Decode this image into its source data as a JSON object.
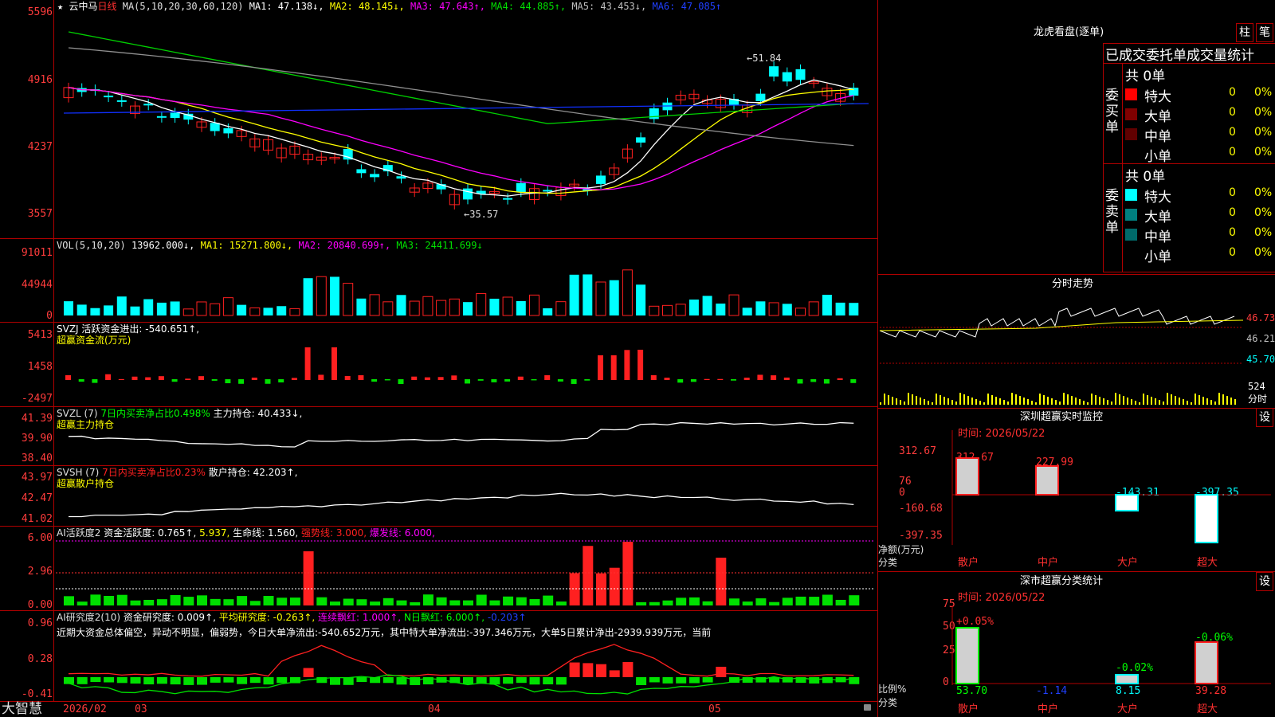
{
  "colors": {
    "up": "#ff2020",
    "down": "#00ffff",
    "grid": "#b00000",
    "ma_white": "#ffffff",
    "ma_yellow": "#ffff00",
    "ma_magenta": "#ff00ff",
    "ma_green": "#00d000",
    "ma_gray": "#909090",
    "ma_blue": "#1030ff"
  },
  "title": {
    "star": "★",
    "stock": "云中马",
    "period": "日线",
    "ma_set": "MA(5,10,20,30,60,120)",
    "ma1": "MA1: 47.138↓,",
    "ma2": "MA2: 48.145↓,",
    "ma3": "MA3: 47.643↑,",
    "ma4": "MA4: 44.885↑,",
    "ma5": "MA5: 43.453↓,",
    "ma6": "MA6: 47.085↑"
  },
  "price_panel": {
    "yticks": [
      "5596",
      "4916",
      "4237",
      "3557"
    ],
    "high_marker": "←51.84",
    "low_marker": "←35.57"
  },
  "vol_panel": {
    "header": "VOL(5,10,20)",
    "vol": "13962.000↓,",
    "ma1": "MA1: 15271.800↓,",
    "ma2": "MA2: 20840.699↑,",
    "ma3": "MA3: 24411.699↓",
    "yticks": [
      "91011",
      "44944",
      "0"
    ]
  },
  "svzj_panel": {
    "line1_a": "SVZJ  活跃资金进出: -540.651↑,",
    "line2": "超赢资金流(万元)",
    "yticks": [
      "5413",
      "1458",
      "-2497"
    ]
  },
  "svzl_panel": {
    "line1_a": "SVZL (7)",
    "line1_b": "7日内买卖净占比0.498%",
    "line1_c": "主力持仓: 40.433↓,",
    "line2": "超赢主力持仓",
    "yticks": [
      "41.39",
      "39.90",
      "38.40"
    ]
  },
  "svsh_panel": {
    "line1_a": "SVSH (7)",
    "line1_b": "7日内买卖净占比0.23%",
    "line1_c": "散户持仓: 42.203↑,",
    "line2": "超赢散户持仓",
    "yticks": [
      "43.97",
      "42.47",
      "41.02"
    ]
  },
  "ai1_panel": {
    "a": "AI活跃度2",
    "b": "资金活跃度: 0.765↑,",
    "c": "5.937,",
    "d": "生命线: 1.560,",
    "e": "强势线: 3.000,",
    "f": "爆发线: 6.000,",
    "yticks": [
      "6.00",
      "2.96",
      "0.00"
    ]
  },
  "ai2_panel": {
    "a": "AI研究度2(10)",
    "b": "资金研究度: 0.009↑,",
    "c": "平均研究度: -0.263↑,",
    "d": "连续飘红: 1.000↑,",
    "e": "N日飘红: 6.000↑,",
    "f": "-0.203↑",
    "comment": "近期大资金总体偏空，异动不明显，偏弱势，今日大单净流出:-540.652万元，其中特大单净流出:-397.346万元，大单5日累计净出-2939.939万元，当前",
    "yticks": [
      "0.96",
      "0.28",
      "-0.41"
    ]
  },
  "x_axis": {
    "brand": "大智慧",
    "labels": [
      "2026/02",
      "03",
      "04",
      "05"
    ]
  },
  "right": {
    "lhb_title": "龙虎看盘(逐单)",
    "btn_bar": "柱",
    "btn_pen": "笔",
    "stats_title": "已成交委托单成交量统计",
    "buy_group": {
      "label": "委买单",
      "total": "共 0单",
      "rows": [
        {
          "name": "特大",
          "vol": "0",
          "pct": "0%",
          "color": "#ff0000"
        },
        {
          "name": "大单",
          "vol": "0",
          "pct": "0%",
          "color": "#800000"
        },
        {
          "name": "中单",
          "vol": "0",
          "pct": "0%",
          "color": "#600000"
        },
        {
          "name": "小单",
          "vol": "0",
          "pct": "0%",
          "color": "#000000"
        }
      ]
    },
    "sell_group": {
      "label": "委卖单",
      "total": "共 0单",
      "rows": [
        {
          "name": "特大",
          "vol": "0",
          "pct": "0%",
          "color": "#00ffff"
        },
        {
          "name": "大单",
          "vol": "0",
          "pct": "0%",
          "color": "#008080"
        },
        {
          "name": "中单",
          "vol": "0",
          "pct": "0%",
          "color": "#006a6a"
        },
        {
          "name": "小单",
          "vol": "0",
          "pct": "0%",
          "color": "#000000"
        }
      ]
    },
    "intraday_title": "分时走势",
    "intraday_ticks": [
      "46.73",
      "46.21",
      "45.70",
      "524",
      "分时"
    ],
    "sz_title": "深圳超赢实时监控",
    "sz_btn": "设",
    "sz_time": "时间: 2026/05/22",
    "sz_yticks": [
      "312.67",
      "76",
      "0",
      "-160.68",
      "-397.35"
    ],
    "sz_ylabel": "净额(万元)",
    "sz_xlabel": "分类",
    "sz_values": [
      "312.67",
      "227.99",
      "-143.31",
      "-397.35"
    ],
    "categories": [
      "散户",
      "中户",
      "大户",
      "超大"
    ],
    "cls_title": "深市超赢分类统计",
    "cls_btn": "设",
    "cls_time": "时间: 2026/05/22",
    "cls_yticks": [
      "75",
      "50",
      "25",
      "0"
    ],
    "cls_ylabel": "比例%",
    "cls_xlabel": "分类",
    "cls_top": [
      "+0.05%",
      "",
      "-0.02%",
      "-0.06%"
    ],
    "cls_values": [
      "53.70",
      "-1.14",
      "8.15",
      "39.28"
    ]
  }
}
